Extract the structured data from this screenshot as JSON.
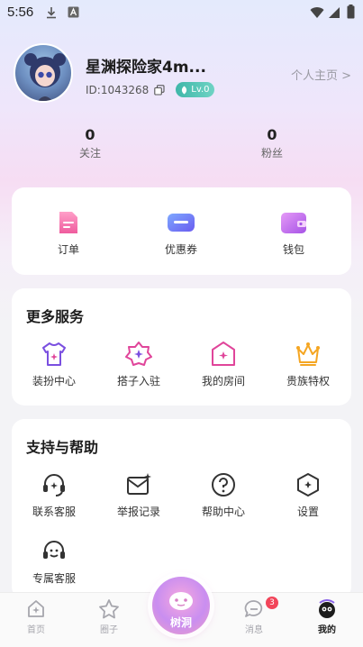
{
  "status_bar": {
    "time": "5:56"
  },
  "profile": {
    "username": "星渊探险家4m...",
    "user_id": "ID:1043268",
    "level": "Lv.0",
    "homepage_link": "个人主页 >"
  },
  "stats": [
    {
      "value": "0",
      "label": "关注"
    },
    {
      "value": "0",
      "label": "粉丝"
    }
  ],
  "wallet_card": {
    "items": [
      {
        "label": "订单",
        "icon": "order-icon"
      },
      {
        "label": "优惠券",
        "icon": "coupon-icon"
      },
      {
        "label": "钱包",
        "icon": "wallet-icon"
      }
    ]
  },
  "more_services": {
    "title": "更多服务",
    "items": [
      {
        "label": "装扮中心",
        "icon": "tshirt-icon"
      },
      {
        "label": "搭子入驻",
        "icon": "star-badge-icon"
      },
      {
        "label": "我的房间",
        "icon": "home-icon"
      },
      {
        "label": "贵族特权",
        "icon": "crown-icon"
      }
    ]
  },
  "support": {
    "title": "支持与帮助",
    "items": [
      {
        "label": "联系客服",
        "icon": "headset-icon"
      },
      {
        "label": "举报记录",
        "icon": "report-mail-icon"
      },
      {
        "label": "帮助中心",
        "icon": "help-icon"
      },
      {
        "label": "设置",
        "icon": "settings-icon"
      },
      {
        "label": "专属客服",
        "icon": "smile-headset-icon"
      }
    ]
  },
  "tabbar": {
    "items": [
      {
        "label": "首页",
        "icon": "home-tab-icon"
      },
      {
        "label": "圈子",
        "icon": "circle-star-tab-icon"
      },
      {
        "label": "树洞",
        "icon": "treehole-icon"
      },
      {
        "label": "消息",
        "icon": "message-tab-icon",
        "badge": "3"
      },
      {
        "label": "我的",
        "icon": "profile-tab-icon"
      }
    ],
    "active": "我的"
  },
  "colors": {
    "accent_orange": "#f5a623",
    "accent_pink": "#e0459a",
    "badge_red": "#f2455a",
    "level_teal": "#3fb7a9"
  }
}
